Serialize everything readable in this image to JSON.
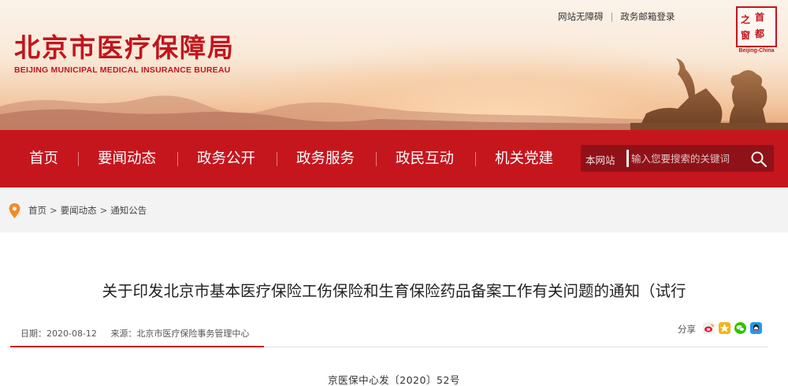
{
  "header": {
    "title": "北京市医疗保障局",
    "subtitle": "BEIJING MUNICIPAL MEDICAL INSURANCE BUREAU",
    "top_links": [
      "网站无障碍",
      "政务邮箱登录"
    ],
    "seal": {
      "chars": [
        "首",
        "都",
        "之",
        "窗"
      ],
      "caption": "Beijing-China"
    }
  },
  "nav": {
    "items": [
      "首页",
      "要闻动态",
      "政务公开",
      "政务服务",
      "政民互动",
      "机关党建"
    ]
  },
  "search": {
    "scope": "本网站",
    "placeholder": "输入您要搜索的关键词",
    "icon": "search-icon"
  },
  "breadcrumb": {
    "items": [
      "首页",
      "要闻动态",
      "通知公告"
    ],
    "separator": ">"
  },
  "article": {
    "title": "关于印发北京市基本医疗保险工伤保险和生育保险药品备案工作有关问题的通知（试行",
    "date": "日期：2020-08-12",
    "source": "来源：北京市医疗保险事务管理中心",
    "share_label": "分享",
    "doc_number": "京医保中心发〔2020〕52号"
  },
  "colors": {
    "brand_red": "#c5161e",
    "search_bg": "#8f1218",
    "breadcrumb_bg": "#f3f3f3"
  }
}
